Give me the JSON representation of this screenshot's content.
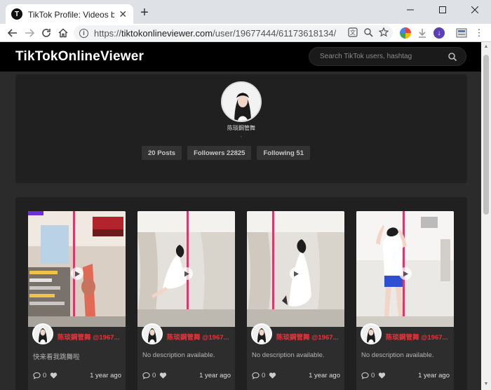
{
  "browser": {
    "tab_favicon": "T",
    "tab_title": "TikTok Profile: Videos by @陈琰",
    "url_prefix": "https://",
    "url_host": "tiktokonlineviewer.com",
    "url_path": "/user/19677444/61173618134/"
  },
  "site": {
    "logo": "TikTokOnlineViewer",
    "search_placeholder": "Search TikTok users, hashtag"
  },
  "profile": {
    "username": "陈琰鋼管舞",
    "sub": "-",
    "stats": {
      "posts": "20 Posts",
      "followers": "Followers 22825",
      "following": "Following 51"
    }
  },
  "videos": [
    {
      "author": "陈琰鋼管舞 @1967...",
      "description": "快来看我跳舞啦",
      "comments": "0",
      "time": "1 year ago"
    },
    {
      "author": "陈琰鋼管舞 @1967...",
      "description": "No description available.",
      "comments": "0",
      "time": "1 year ago"
    },
    {
      "author": "陈琰鋼管舞 @1967...",
      "description": "No description available.",
      "comments": "0",
      "time": "1 year ago"
    },
    {
      "author": "陈琰鋼管舞 @1967...",
      "description": "No description available.",
      "comments": "0",
      "time": "1 year ago"
    }
  ],
  "colors": {
    "accent_name": "#e8333a",
    "header_bg": "#000000",
    "panel_bg": "#202020"
  }
}
